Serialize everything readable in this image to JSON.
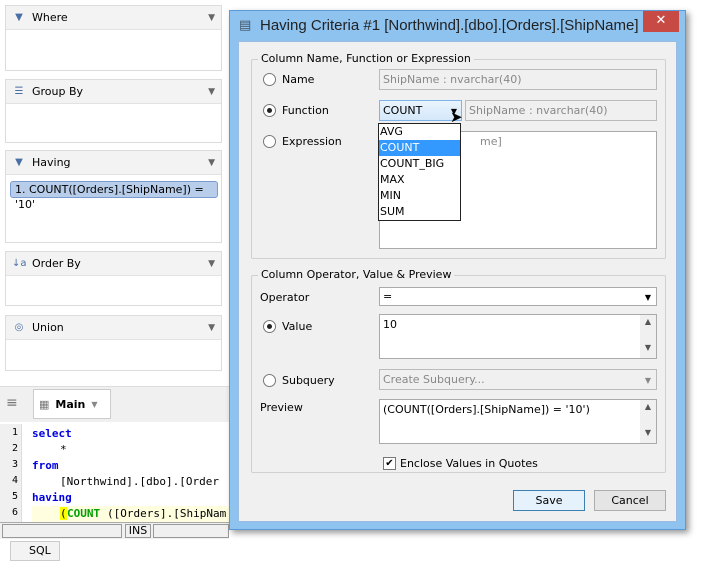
{
  "panels": [
    {
      "label": "Where",
      "icon": "filter-icon"
    },
    {
      "label": "Group By",
      "icon": "group-icon"
    },
    {
      "label": "Having",
      "icon": "having-icon",
      "items": [
        "1. COUNT([Orders].[ShipName]) = '10'"
      ]
    },
    {
      "label": "Order By",
      "icon": "sort-az-icon"
    },
    {
      "label": "Union",
      "icon": "union-icon"
    }
  ],
  "tabs": {
    "main": "Main",
    "bottom": "SQL"
  },
  "editor": {
    "lines": [
      "1",
      "2",
      "3",
      "4",
      "5",
      "6"
    ],
    "code": [
      "select",
      "*",
      "from",
      "[Northwind].[dbo].[Order",
      "having",
      "COUNT",
      "([Orders].[ShipNam"
    ],
    "status_mode": "INS"
  },
  "dialog": {
    "title": "Having Criteria #1 [Northwind].[dbo].[Orders].[ShipName]",
    "close": "✕",
    "group1": "Column Name, Function or Expression",
    "name_label": "Name",
    "name_value": "ShipName : nvarchar(40)",
    "function_label": "Function",
    "function_value": "COUNT",
    "function_arg": "ShipName : nvarchar(40)",
    "function_options": [
      "AVG",
      "COUNT",
      "COUNT_BIG",
      "MAX",
      "MIN",
      "SUM"
    ],
    "expression_label": "Expression",
    "expression_value": "me]",
    "group2": "Column Operator, Value & Preview",
    "operator_label": "Operator",
    "operator_value": "=",
    "value_label": "Value",
    "value_value": "10",
    "subquery_label": "Subquery",
    "subquery_value": "Create Subquery...",
    "preview_label": "Preview",
    "preview_value": "(COUNT([Orders].[ShipName]) = '10')",
    "enclose_label": "Enclose Values in Quotes",
    "enclose_checked": true,
    "save": "Save",
    "cancel": "Cancel"
  }
}
